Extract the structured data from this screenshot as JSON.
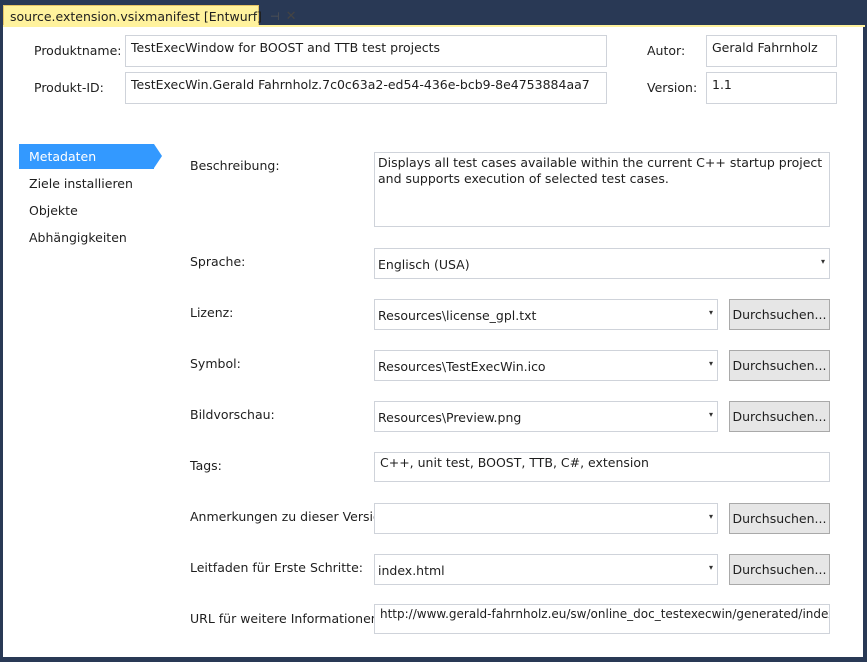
{
  "tab": {
    "title": "source.extension.vsixmanifest [Entwurf]",
    "pin_glyph": "⊣",
    "close_glyph": "✕"
  },
  "header": {
    "product_name_label": "Produktname:",
    "product_name": "TestExecWindow for BOOST and TTB test projects",
    "product_id_label": "Produkt-ID:",
    "product_id": "TestExecWin.Gerald Fahrnholz.7c0c63a2-ed54-436e-bcb9-8e4753884aa7",
    "author_label": "Autor:",
    "author": "Gerald Fahrnholz",
    "version_label": "Version:",
    "version": "1.1"
  },
  "nav": {
    "items": [
      {
        "label": "Metadaten",
        "active": true
      },
      {
        "label": "Ziele installieren",
        "active": false
      },
      {
        "label": "Objekte",
        "active": false
      },
      {
        "label": "Abhängigkeiten",
        "active": false
      }
    ]
  },
  "form": {
    "description_label": "Beschreibung:",
    "description": "Displays all test cases available within the current C++ startup project and supports execution of selected test cases.",
    "language_label": "Sprache:",
    "language": "Englisch (USA)",
    "license_label": "Lizenz:",
    "license": "Resources\\license_gpl.txt",
    "icon_label": "Symbol:",
    "icon": "Resources\\TestExecWin.ico",
    "preview_label": "Bildvorschau:",
    "preview": "Resources\\Preview.png",
    "tags_label": "Tags:",
    "tags": "C++, unit test, BOOST, TTB, C#, extension",
    "release_notes_label": "Anmerkungen zu dieser Version:",
    "release_notes": "",
    "getting_started_label": "Leitfaden für Erste Schritte:",
    "getting_started": "index.html",
    "more_info_label": "URL für weitere Informationen:",
    "more_info": "http://www.gerald-fahrnholz.eu/sw/online_doc_testexecwin/generated/index.html",
    "browse_label": "Durchsuchen...",
    "dropdown_glyph": "▾"
  },
  "colors": {
    "frame": "#293955",
    "tab": "#fff29d",
    "nav_active": "#3399ff"
  }
}
